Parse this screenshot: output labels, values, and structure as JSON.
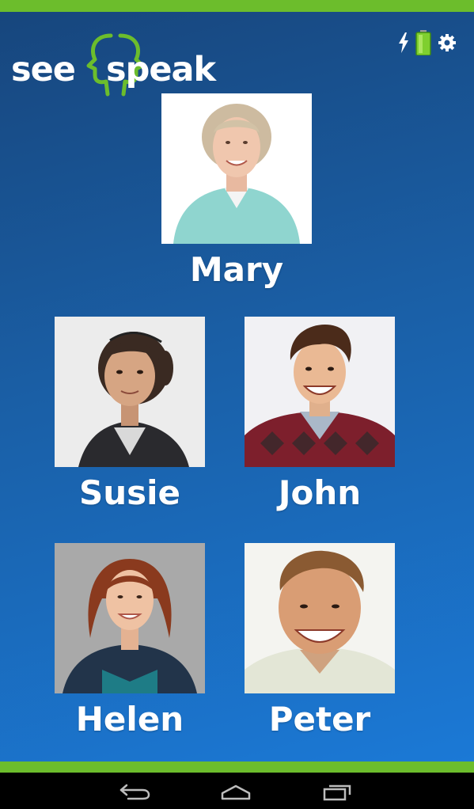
{
  "app": {
    "logo_see": "see",
    "logo_speak": "speak",
    "colors": {
      "accent_green": "#6cbd2c",
      "background_top": "#17467d",
      "background_bottom": "#1b79d6",
      "text": "#ffffff"
    }
  },
  "status": {
    "icons": [
      "lightning-icon",
      "battery-icon",
      "gear-icon"
    ]
  },
  "people": [
    {
      "name": "Mary"
    },
    {
      "name": "Susie"
    },
    {
      "name": "John"
    },
    {
      "name": "Helen"
    },
    {
      "name": "Peter"
    }
  ],
  "navigation": {
    "icons": [
      "back-icon",
      "home-icon",
      "recent-apps-icon"
    ]
  }
}
